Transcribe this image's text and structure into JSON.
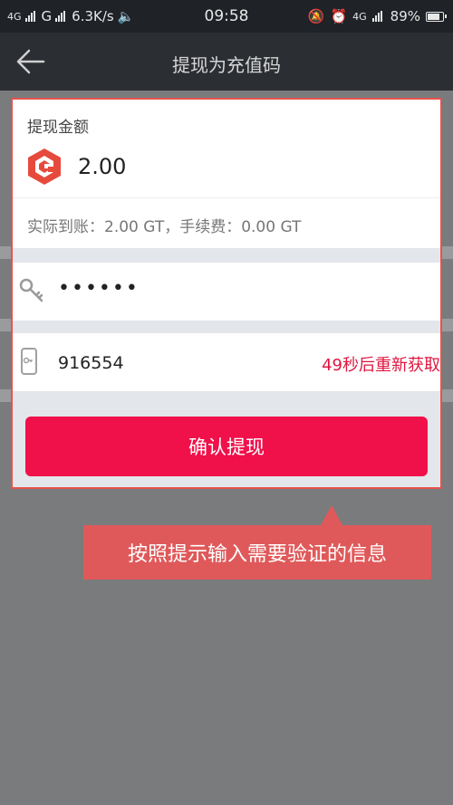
{
  "status_bar": {
    "network_left": "4G",
    "network_left2": "G",
    "speed": "6.3K/s",
    "time": "09:58",
    "network_right": "4G",
    "battery": "89%",
    "battery_level": 0.89
  },
  "header": {
    "title": "提现为充值码",
    "back_icon": "back-arrow-icon"
  },
  "amount": {
    "label": "提现金额",
    "value": "2.00",
    "logo_icon": "gt-logo-icon",
    "fee_text": "实际到账：2.00 GT，手续费：0.00 GT"
  },
  "password": {
    "icon": "key-icon",
    "value": "••••••"
  },
  "verification": {
    "icon": "phone-icon",
    "code": "916554",
    "resend_label": "49秒后重新获取"
  },
  "confirm_button": {
    "label": "确认提现"
  },
  "tooltip": {
    "text": "按照提示输入需要验证的信息"
  },
  "colors": {
    "accent": "#f0104a",
    "highlight_border": "#e8514c",
    "tooltip_bg": "#e0595a"
  }
}
